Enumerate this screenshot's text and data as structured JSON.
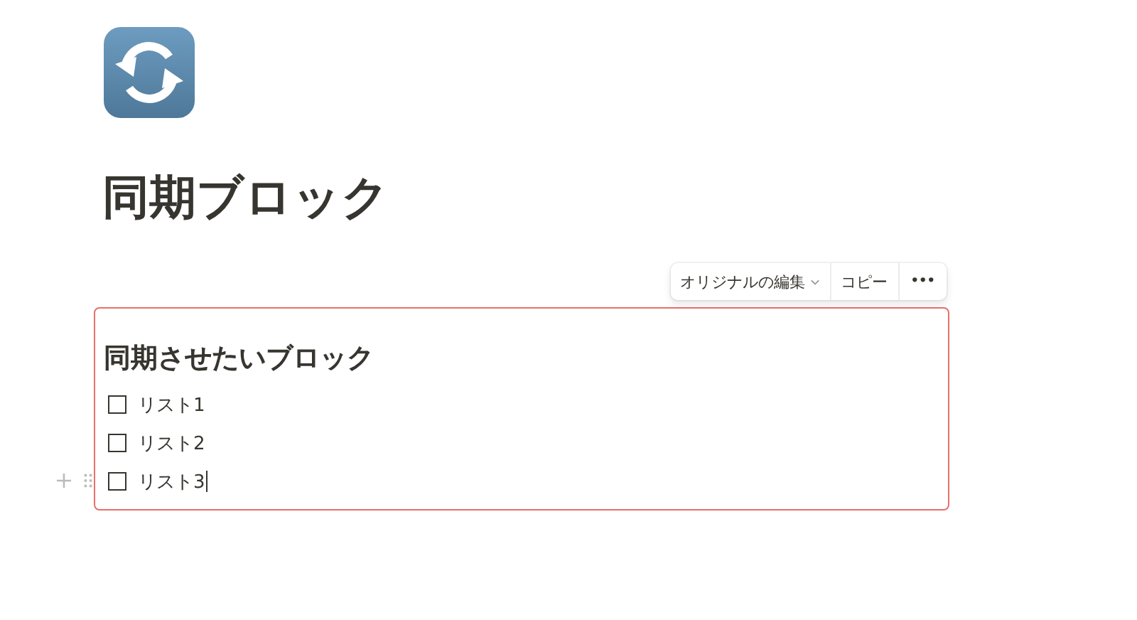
{
  "page": {
    "title": "同期ブロック"
  },
  "toolbar": {
    "edit_original": "オリジナルの編集",
    "copy": "コピー",
    "more": "•••"
  },
  "synced_block": {
    "heading": "同期させたいブロック",
    "items": [
      {
        "text": "リスト1",
        "checked": false
      },
      {
        "text": "リスト2",
        "checked": false
      },
      {
        "text": "リスト3",
        "checked": false
      }
    ]
  }
}
